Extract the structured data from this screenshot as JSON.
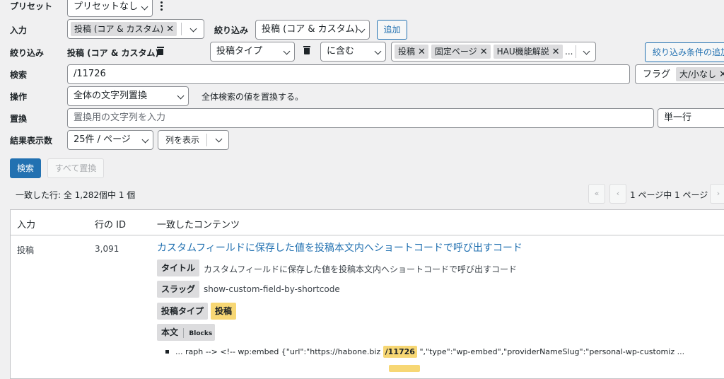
{
  "preset": {
    "label": "プリセット",
    "value": "プリセットなし",
    "menu_icon": "kebab-icon"
  },
  "source": {
    "label": "入力",
    "tags": [
      "投稿 (コア & カスタム)"
    ],
    "filter_label": "絞り込み",
    "filter_value": "投稿 (コア & カスタム)",
    "add_label": "追加"
  },
  "filters": {
    "label": "絞り込み",
    "source_name": "投稿 (コア & カスタム)",
    "field_value": "投稿タイプ",
    "operator_value": "に含む",
    "values": [
      "投稿",
      "固定ページ",
      "HAU機能解説"
    ],
    "ellipsis": "...",
    "add_condition_label": "絞り込み条件の追加"
  },
  "search": {
    "label": "検索",
    "value": "/11726",
    "flags_label": "フラグ",
    "flag_tag": "大/小なし"
  },
  "action": {
    "label": "操作",
    "value": "全体の文字列置換",
    "description": "全体検索の値を置換する。"
  },
  "replace": {
    "label": "置換",
    "placeholder": "置換用の文字列を入力",
    "mode": "単一行"
  },
  "results_per_page": {
    "label": "結果表示数",
    "value": "25件 / ページ",
    "columns_label": "列を表示"
  },
  "buttons": {
    "search": "検索",
    "replace_all": "すべて置換"
  },
  "summary": "一致した行: 全 1,282個中 1 個",
  "pagination": {
    "first": "«",
    "prev": "‹",
    "info": "1 ページ中 1 ページ",
    "next": "›"
  },
  "table": {
    "headers": {
      "source": "入力",
      "row_id": "行の ID",
      "content": "一致したコンテンツ"
    },
    "row": {
      "source": "投稿",
      "row_id": "3,091",
      "title_link": "カスタムフィールドに保存した値を投稿本文内へショートコードで呼び出すコード",
      "fields": {
        "title_label": "タイトル",
        "title_value": "カスタムフィールドに保存した値を投稿本文内へショートコードで呼び出すコード",
        "slug_label": "スラッグ",
        "slug_value": "show-custom-field-by-shortcode",
        "post_type_label": "投稿タイプ",
        "post_type_value": "投稿",
        "content_label": "本文",
        "content_sub": "Blocks"
      },
      "match": {
        "before": "... raph --> <!-- wp:embed {\"url\":\"https://habone.biz",
        "highlight": "/11726",
        "after": "\",\"type\":\"wp-embed\",\"providerNameSlug\":\"personal-wp-customiz ..."
      }
    }
  },
  "colors": {
    "accent": "#2271b1",
    "highlight": "#f7d774",
    "background": "#f0f0f1"
  }
}
